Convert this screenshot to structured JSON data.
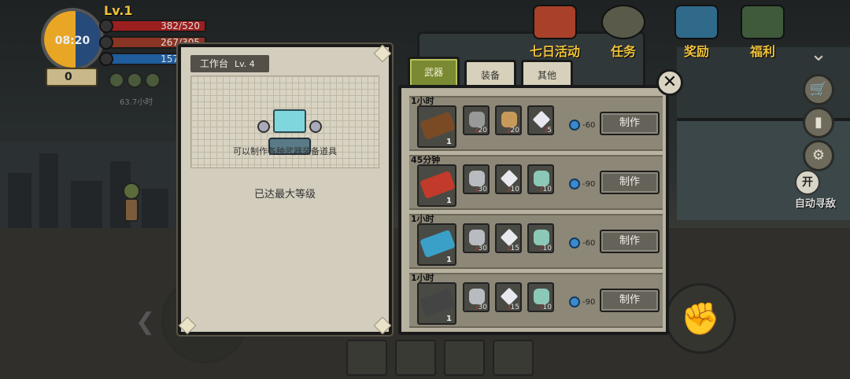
{
  "hud": {
    "level": "Lv.1",
    "time": "08:20",
    "hp": "382/520",
    "food": "267/305",
    "water": "157/160",
    "coins": "0",
    "small_text": "63.7小时"
  },
  "top_icons": [
    {
      "label": "七日活动",
      "icon": "gift-box-icon"
    },
    {
      "label": "任务",
      "icon": "walkie-talkie-icon"
    },
    {
      "label": "奖励",
      "icon": "crate-icon"
    },
    {
      "label": "福利",
      "icon": "supply-box-icon"
    }
  ],
  "side": {
    "auto_seek": "自动寻敌",
    "toggle": "开"
  },
  "workbench": {
    "title": "工作台",
    "level": "Lv. 4",
    "description": "可以制作各种武器装备道具",
    "max_text": "已达最大等级"
  },
  "tabs": [
    {
      "label": "武器",
      "active": true
    },
    {
      "label": "装备",
      "active": false
    },
    {
      "label": "其他",
      "active": false
    }
  ],
  "recipes": [
    {
      "time": "1小时",
      "count": "1",
      "weapon_icon": "rifle-icon",
      "materials": [
        {
          "icon": "gear-parts-icon",
          "have": "/",
          "need": "20"
        },
        {
          "icon": "wood-planks-icon",
          "have": "/",
          "need": "20"
        },
        {
          "icon": "crystal-icon",
          "have": "/",
          "need": "5"
        }
      ],
      "cost": "-60",
      "button": "制作"
    },
    {
      "time": "45分钟",
      "count": "1",
      "weapon_icon": "stop-sign-axe-icon",
      "materials": [
        {
          "icon": "pipe-icon",
          "have": "/",
          "need": "30"
        },
        {
          "icon": "crystal-icon",
          "have": "/",
          "need": "10"
        },
        {
          "icon": "cloth-icon",
          "have": "/",
          "need": "10"
        }
      ],
      "cost": "-90",
      "button": "制作"
    },
    {
      "time": "1小时",
      "count": "1",
      "weapon_icon": "pistol-icon",
      "materials": [
        {
          "icon": "pipe-icon",
          "have": "/",
          "need": "30"
        },
        {
          "icon": "crystal-icon",
          "have": "/",
          "need": "15"
        },
        {
          "icon": "cloth-icon",
          "have": "/",
          "need": "10"
        }
      ],
      "cost": "-60",
      "button": "制作"
    },
    {
      "time": "1小时",
      "count": "1",
      "weapon_icon": "assault-rifle-icon",
      "materials": [
        {
          "icon": "pipe-icon",
          "have": "/",
          "need": "30"
        },
        {
          "icon": "crystal-icon",
          "have": "/",
          "need": "15"
        },
        {
          "icon": "cloth-icon",
          "have": "/",
          "need": "10"
        }
      ],
      "cost": "-90",
      "button": "制作"
    }
  ],
  "colors": {
    "accent_tab": "#7a8a32",
    "hp": "#9c1f1f",
    "water": "#1f5d9c",
    "level": "#f0c23a"
  }
}
